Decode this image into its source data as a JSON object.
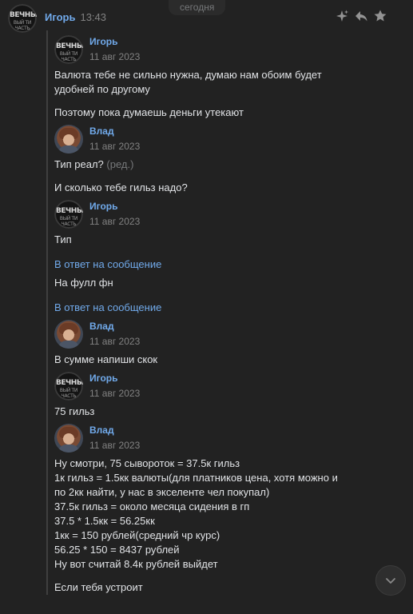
{
  "date_divider": "сегодня",
  "main": {
    "sender": "Игорь",
    "time": "13:43"
  },
  "avatars": {
    "igor_line1": "ВЕЧНЫ",
    "igor_line2": "ВЫЙ ТИ ЧАСТЬ"
  },
  "forwarded": [
    {
      "sender": "Игорь",
      "date": "11 авг 2023",
      "avatar": "igor",
      "items": [
        {
          "type": "text",
          "text": "Валюта тебе не сильно нужна, думаю нам обоим будет\nудобней по другому"
        },
        {
          "type": "text",
          "text": "Поэтому пока думаешь деньги утекают"
        }
      ]
    },
    {
      "sender": "Влад",
      "date": "11 авг 2023",
      "avatar": "vlad",
      "items": [
        {
          "type": "text",
          "text": "Тип реал?",
          "suffix": " (ред.)"
        },
        {
          "type": "text",
          "text": "И сколько тебе гильз надо?"
        }
      ]
    },
    {
      "sender": "Игорь",
      "date": "11 авг 2023",
      "avatar": "igor",
      "items": [
        {
          "type": "text",
          "text": "Тип"
        },
        {
          "type": "link",
          "text": "В ответ на сообщение"
        },
        {
          "type": "text",
          "text": "На фулл фн"
        },
        {
          "type": "link",
          "text": "В ответ на сообщение"
        }
      ]
    },
    {
      "sender": "Влад",
      "date": "11 авг 2023",
      "avatar": "vlad",
      "items": [
        {
          "type": "text",
          "text": "В сумме напиши скок"
        }
      ]
    },
    {
      "sender": "Игорь",
      "date": "11 авг 2023",
      "avatar": "igor",
      "items": [
        {
          "type": "text",
          "text": "75 гильз"
        }
      ]
    },
    {
      "sender": "Влад",
      "date": "11 авг 2023",
      "avatar": "vlad",
      "items": [
        {
          "type": "text",
          "text": "Ну смотри, 75 сывороток = 37.5к гильз\n1к гильз = 1.5кк валюты(для платников цена, хотя можно и\nпо 2кк найти, у нас в экселенте чел покупал)\n37.5к гильз = около месяца сидения в гп\n37.5 * 1.5кк = 56.25кк\n1кк = 150 рублей(средний чр курс)\n56.25 * 150 = 8437 рублей\nНу вот считай 8.4к рублей выйдет"
        },
        {
          "type": "text",
          "text": "Если тебя устроит"
        }
      ]
    }
  ]
}
